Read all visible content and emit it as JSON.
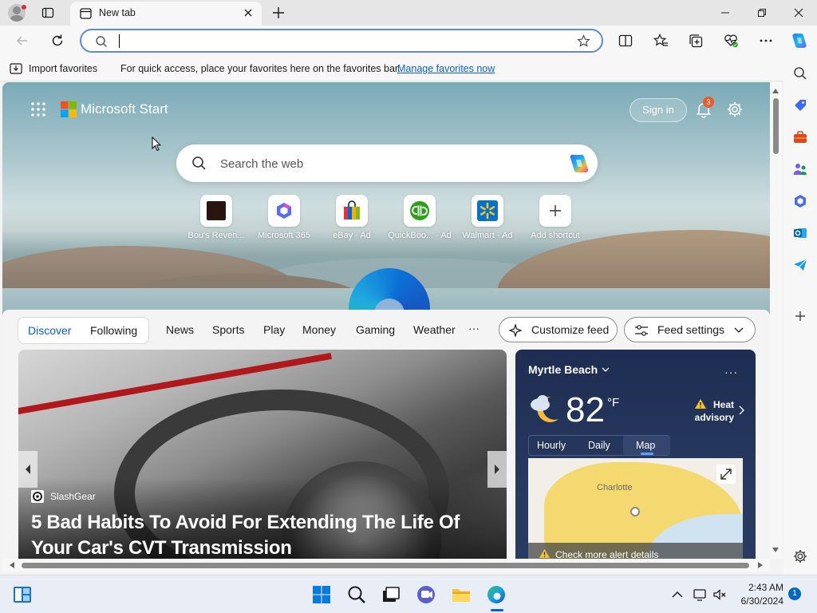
{
  "browser": {
    "tab_title": "New tab",
    "address_value": "",
    "favorites_bar": {
      "import_label": "Import favorites",
      "message": "For quick access, place your favorites here on the favorites bar.",
      "link": "Manage favorites now"
    }
  },
  "start_page": {
    "brand": "Microsoft Start",
    "sign_in_label": "Sign in",
    "notification_count": "3",
    "search_placeholder": "Search the web",
    "shortcuts": [
      {
        "label": "Bou's Reven...",
        "icon": "site-favicon-dark"
      },
      {
        "label": "Microsoft 365",
        "icon": "microsoft-365-icon"
      },
      {
        "label": "eBay · Ad",
        "icon": "ebay-bag-icon"
      },
      {
        "label": "QuickBoo... · Ad",
        "icon": "quickbooks-icon"
      },
      {
        "label": "Walmart · Ad",
        "icon": "walmart-spark-icon"
      },
      {
        "label": "Add shortcut",
        "icon": "plus-icon"
      }
    ],
    "feed_nav": {
      "primary_tabs": [
        "Discover",
        "Following"
      ],
      "active_tab": "Discover",
      "tabs": [
        "News",
        "Sports",
        "Play",
        "Money",
        "Gaming",
        "Weather"
      ],
      "more": "···",
      "customize_label": "Customize feed",
      "settings_label": "Feed settings"
    },
    "news_card": {
      "source": "SlashGear",
      "headline": "5 Bad Habits To Avoid For Extending The Life Of Your Car's CVT Transmission"
    },
    "weather": {
      "location": "Myrtle Beach",
      "more": "···",
      "temperature": "82",
      "unit": "°F",
      "alert": "Heat advisory",
      "tabs": [
        "Hourly",
        "Daily",
        "Map"
      ],
      "active_tab": "Map",
      "map_city": "Charlotte",
      "footer": "Check more alert details"
    }
  },
  "taskbar": {
    "time": "2:43 AM",
    "date": "6/30/2024",
    "notification_count": "1"
  },
  "colors": {
    "accent": "#0067c0",
    "link": "#0f5fc8",
    "weather_bg": "#1e2d52",
    "heat_alert": "#f3d663"
  }
}
